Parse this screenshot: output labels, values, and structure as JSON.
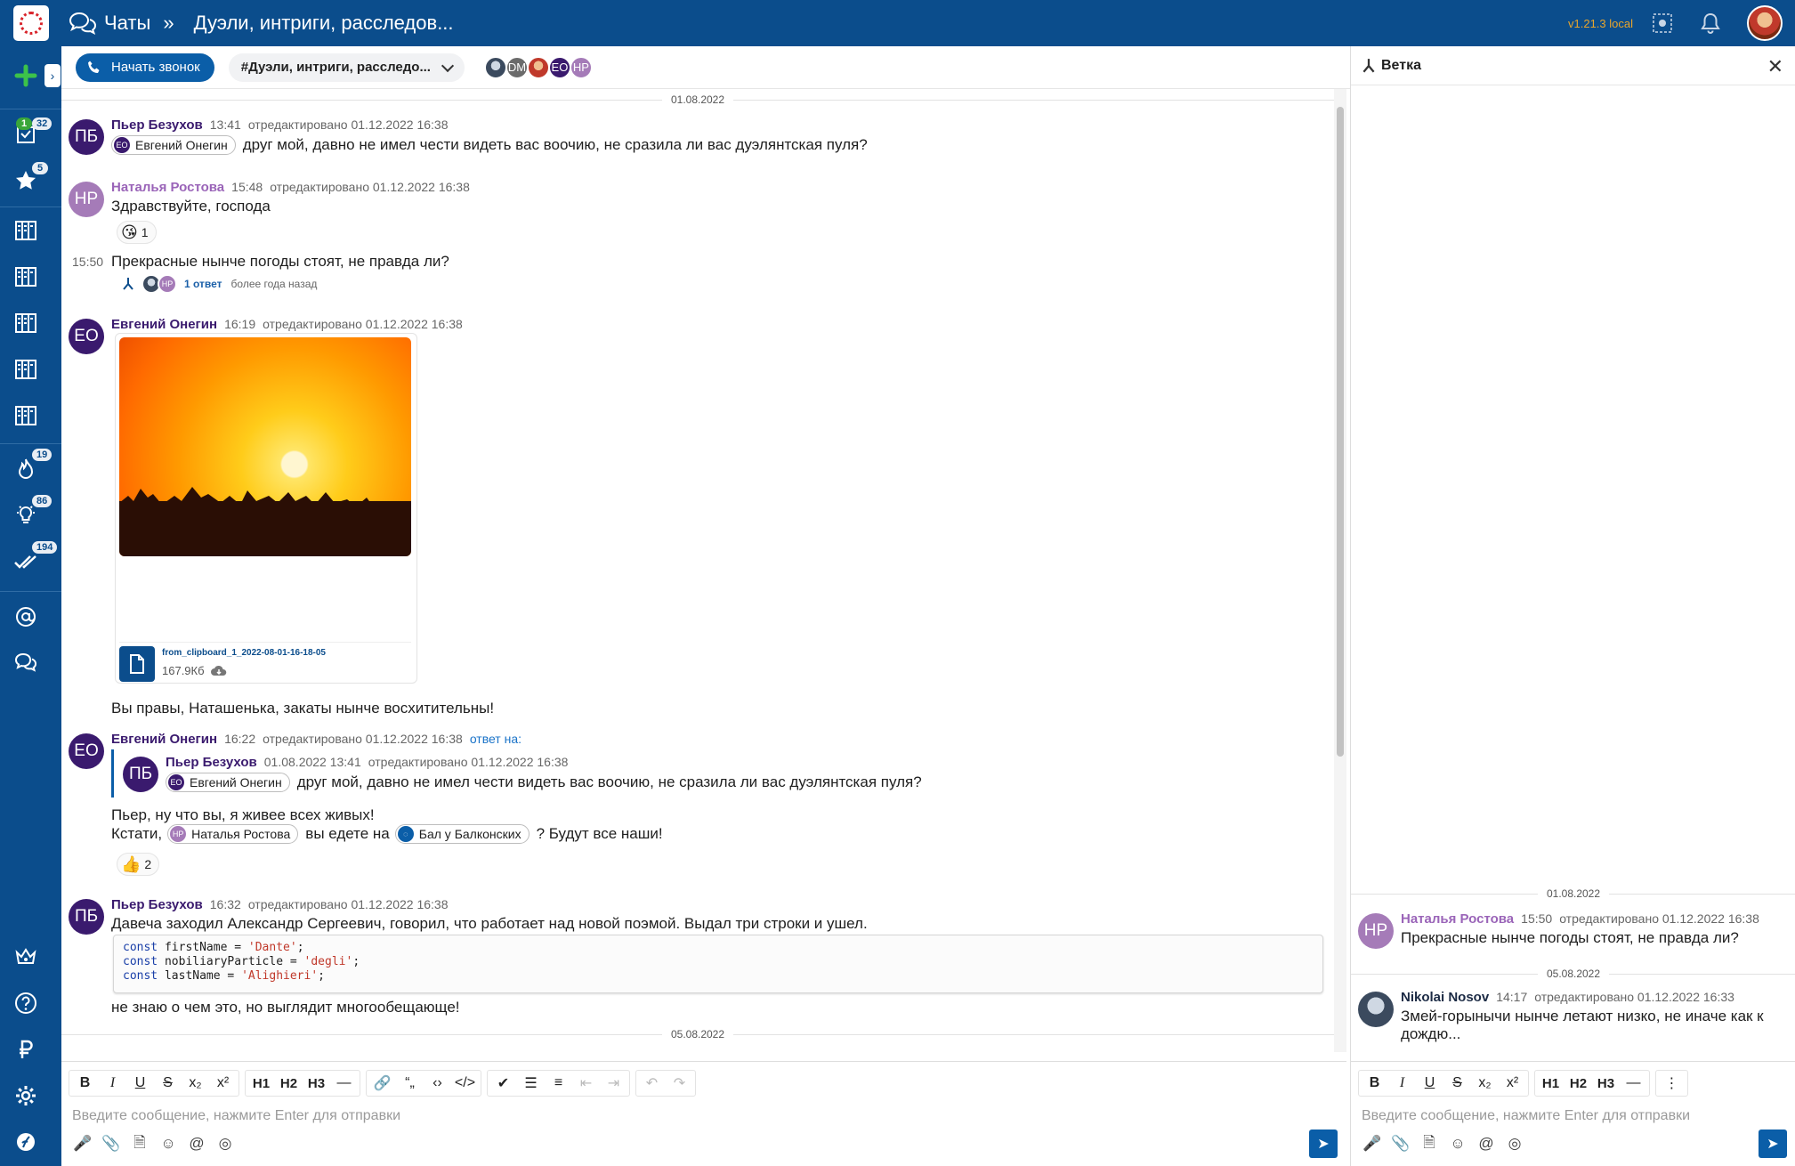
{
  "header": {
    "breadcrumb_root": "Чаты",
    "breadcrumb_sep": "»",
    "breadcrumb_current": "Дуэли, интриги, расследов...",
    "version": "v1.21.3 local"
  },
  "sidebar": {
    "badges": {
      "tasks_green": "1",
      "tasks": "32",
      "favorites": "5",
      "hot": "19",
      "ideas": "86",
      "done": "194"
    }
  },
  "toolbar": {
    "call_label": "Начать звонок",
    "channel_label": "#Дуэли, интриги, расследо...",
    "members": [
      "",
      "DM",
      "",
      "EO",
      "HP"
    ]
  },
  "messages": {
    "date1": "01.08.2022",
    "date2": "05.08.2022",
    "m1": {
      "initials": "ПБ",
      "author": "Пьер Безухов",
      "time": "13:41",
      "edited": "отредактировано 01.12.2022 16:38",
      "mention": "Евгений Онегин",
      "mention_initials": "ЕО",
      "text": "друг мой, давно не имел чести видеть вас воочию, не сразила ли вас дуэлянтская пуля?"
    },
    "m2": {
      "initials": "НР",
      "author": "Наталья Ростова",
      "time": "15:48",
      "edited": "отредактировано 01.12.2022 16:38",
      "text": "Здравствуйте, господа",
      "reaction_emoji": "😘",
      "reaction_count": "1"
    },
    "m3": {
      "side_time": "15:50",
      "text": "Прекрасные нынче погоды стоят, не правда ли?",
      "thread_link": "1 ответ",
      "thread_ago": "более года назад",
      "thread_av2": "НР"
    },
    "m4": {
      "initials": "ЕО",
      "author": "Евгений Онегин",
      "time": "16:19",
      "edited": "отредактировано 01.12.2022 16:38",
      "file_name": "from_clipboard_1_2022-08-01-16-18-05",
      "file_size": "167.9Кб",
      "text": "Вы правы, Наташенька, закаты нынче восхитительны!"
    },
    "m5": {
      "initials": "ЕО",
      "author": "Евгений Онегин",
      "time": "16:22",
      "edited": "отредактировано 01.12.2022 16:38",
      "reply_to": "ответ на:",
      "quote": {
        "initials": "ПБ",
        "author": "Пьер Безухов",
        "time": "01.08.2022 13:41",
        "edited": "отредактировано 01.12.2022 16:38",
        "mention": "Евгений Онегин",
        "mention_initials": "ЕО",
        "text": "друг мой, давно не имел чести видеть вас воочию, не сразила ли вас дуэлянтская пуля?"
      },
      "line1": "Пьер, ну что вы, я живее всех живых!",
      "line2_a": "Кстати,",
      "mention_nr": "Наталья Ростова",
      "mention_nr_initials": "НР",
      "line2_b": "вы едете на",
      "mention_ch": "Бал у Балконских",
      "line2_c": "? Будут все наши!",
      "reaction_emoji": "👍",
      "reaction_count": "2"
    },
    "m6": {
      "initials": "ПБ",
      "author": "Пьер Безухов",
      "time": "16:32",
      "edited": "отредактировано 01.12.2022 16:38",
      "text": "Давеча заходил Александр Сергеевич, говорил, что работает над новой поэмой. Выдал три строки и ушел.",
      "code": [
        {
          "kw": "const",
          "name": " firstName = ",
          "str": "'Dante'",
          "end": ";"
        },
        {
          "kw": "const",
          "name": " nobiliaryParticle = ",
          "str": "'degli'",
          "end": ";"
        },
        {
          "kw": "const",
          "name": " lastName = ",
          "str": "'Alighieri'",
          "end": ";"
        }
      ],
      "after": "не знаю о чем это, но выглядит многообещающе!"
    }
  },
  "editor": {
    "placeholder": "Введите сообщение, нажмите Enter для отправки",
    "fmt": {
      "h1": "H1",
      "h2": "H2",
      "h3": "H3",
      "bold": "B",
      "italic": "I",
      "underline": "U",
      "strike": "S"
    }
  },
  "thread_panel": {
    "title": "Ветка",
    "date1": "01.08.2022",
    "date2": "05.08.2022",
    "t1": {
      "initials": "НР",
      "author": "Наталья Ростова",
      "time": "15:50",
      "edited": "отредактировано 01.12.2022 16:38",
      "text": "Прекрасные нынче погоды стоят, не правда ли?"
    },
    "t2": {
      "author": "Nikolai Nosov",
      "time": "14:17",
      "edited": "отредактировано 01.12.2022 16:33",
      "text_1": "Змей-горынычи нынче летают низко, не иначе как к",
      "text_2": "дождю..."
    },
    "placeholder": "Введите сообщение, нажмите Enter для отправки"
  },
  "colors": {
    "brand": "#0b4d8c",
    "accent": "#0b5ea8",
    "author_purple": "#3a1a6e",
    "author_nr": "#9a64b8",
    "version": "#e8a52c"
  }
}
